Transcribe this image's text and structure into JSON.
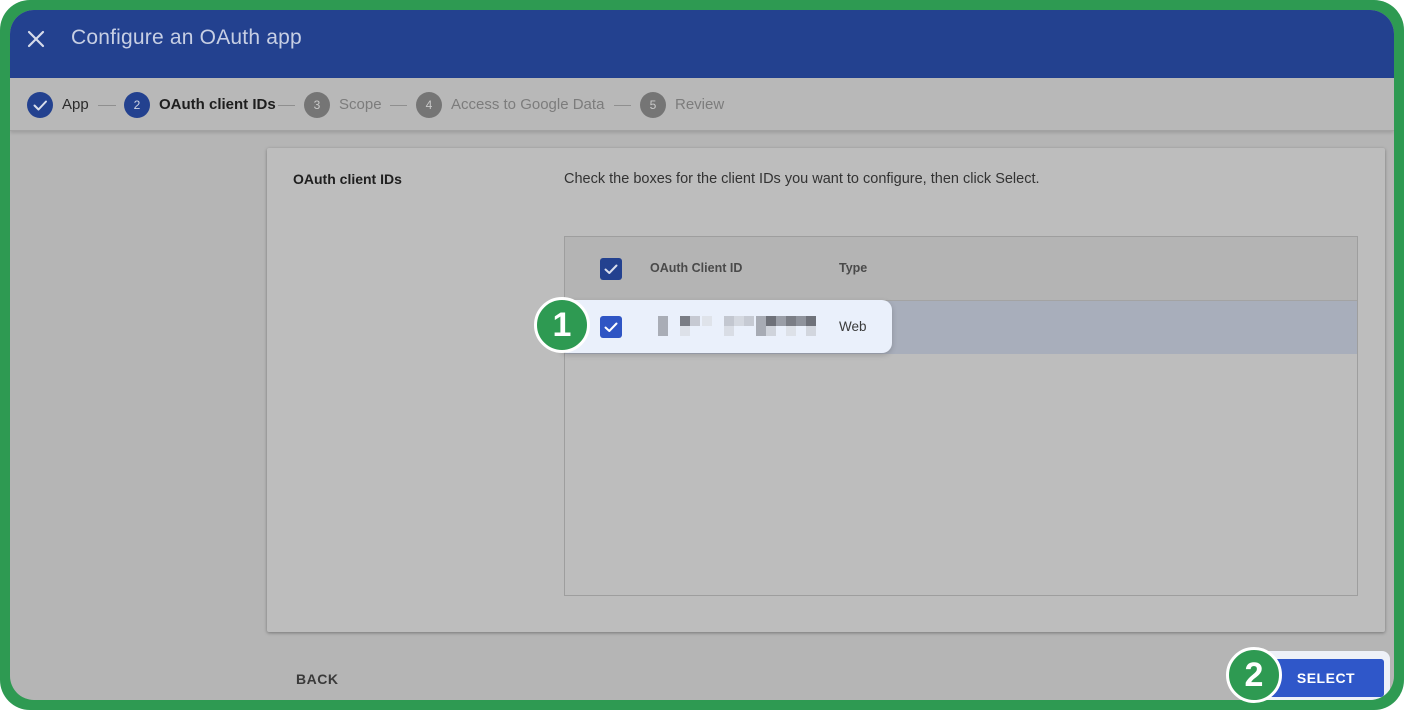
{
  "header": {
    "title": "Configure an OAuth app"
  },
  "stepper": {
    "steps": [
      {
        "number": "1",
        "label": "App",
        "state": "done"
      },
      {
        "number": "2",
        "label": "OAuth client IDs",
        "state": "active"
      },
      {
        "number": "3",
        "label": "Scope",
        "state": "pending"
      },
      {
        "number": "4",
        "label": "Access to Google Data",
        "state": "pending"
      },
      {
        "number": "5",
        "label": "Review",
        "state": "pending"
      }
    ]
  },
  "card": {
    "title": "OAuth client IDs",
    "description": "Check the boxes for the client IDs you want to configure, then click Select."
  },
  "table": {
    "columns": [
      "OAuth Client ID",
      "Type"
    ],
    "rows": [
      {
        "client_id": "",
        "type": "Web",
        "checked": true
      }
    ],
    "select_all_checked": true
  },
  "footer": {
    "back_label": "BACK",
    "select_label": "SELECT"
  },
  "callouts": {
    "one": "1",
    "two": "2"
  },
  "colors": {
    "header_bg": "#23418f",
    "accent": "#2f57c9",
    "frame": "#2e9a52"
  }
}
